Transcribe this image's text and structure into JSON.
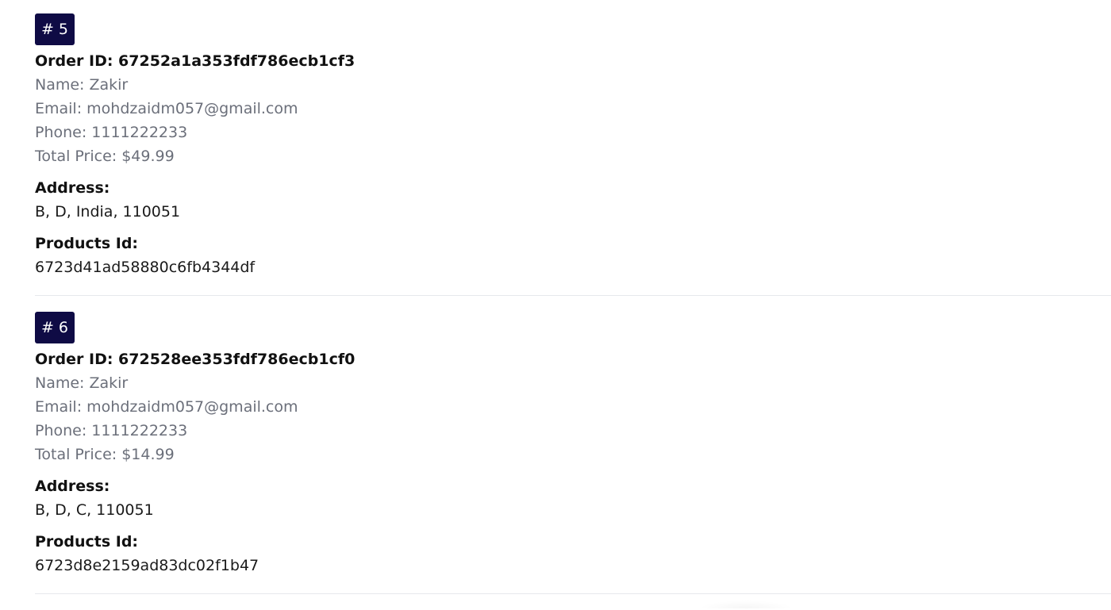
{
  "orders": [
    {
      "badge": "# 5",
      "order_id": "Order ID: 67252a1a353fdf786ecb1cf3",
      "name": "Name: Zakir",
      "email": "Email: mohdzaidm057@gmail.com",
      "phone": "Phone: 1111222233",
      "total": "Total Price: $49.99",
      "address_label": "Address:",
      "address": "B, D, India, 110051",
      "products_label": "Products Id:",
      "products": "6723d41ad58880c6fb4344df"
    },
    {
      "badge": "# 6",
      "order_id": "Order ID: 672528ee353fdf786ecb1cf0",
      "name": "Name: Zakir",
      "email": "Email: mohdzaidm057@gmail.com",
      "phone": "Phone: 1111222233",
      "total": "Total Price: $14.99",
      "address_label": "Address:",
      "address": "B, D, C, 110051",
      "products_label": "Products Id:",
      "products": "6723d8e2159ad83dc02f1b47"
    }
  ],
  "colors": {
    "badge_bg": "#0f0b45",
    "muted_text": "#6b6f7a",
    "divider": "#e6e8ec"
  }
}
